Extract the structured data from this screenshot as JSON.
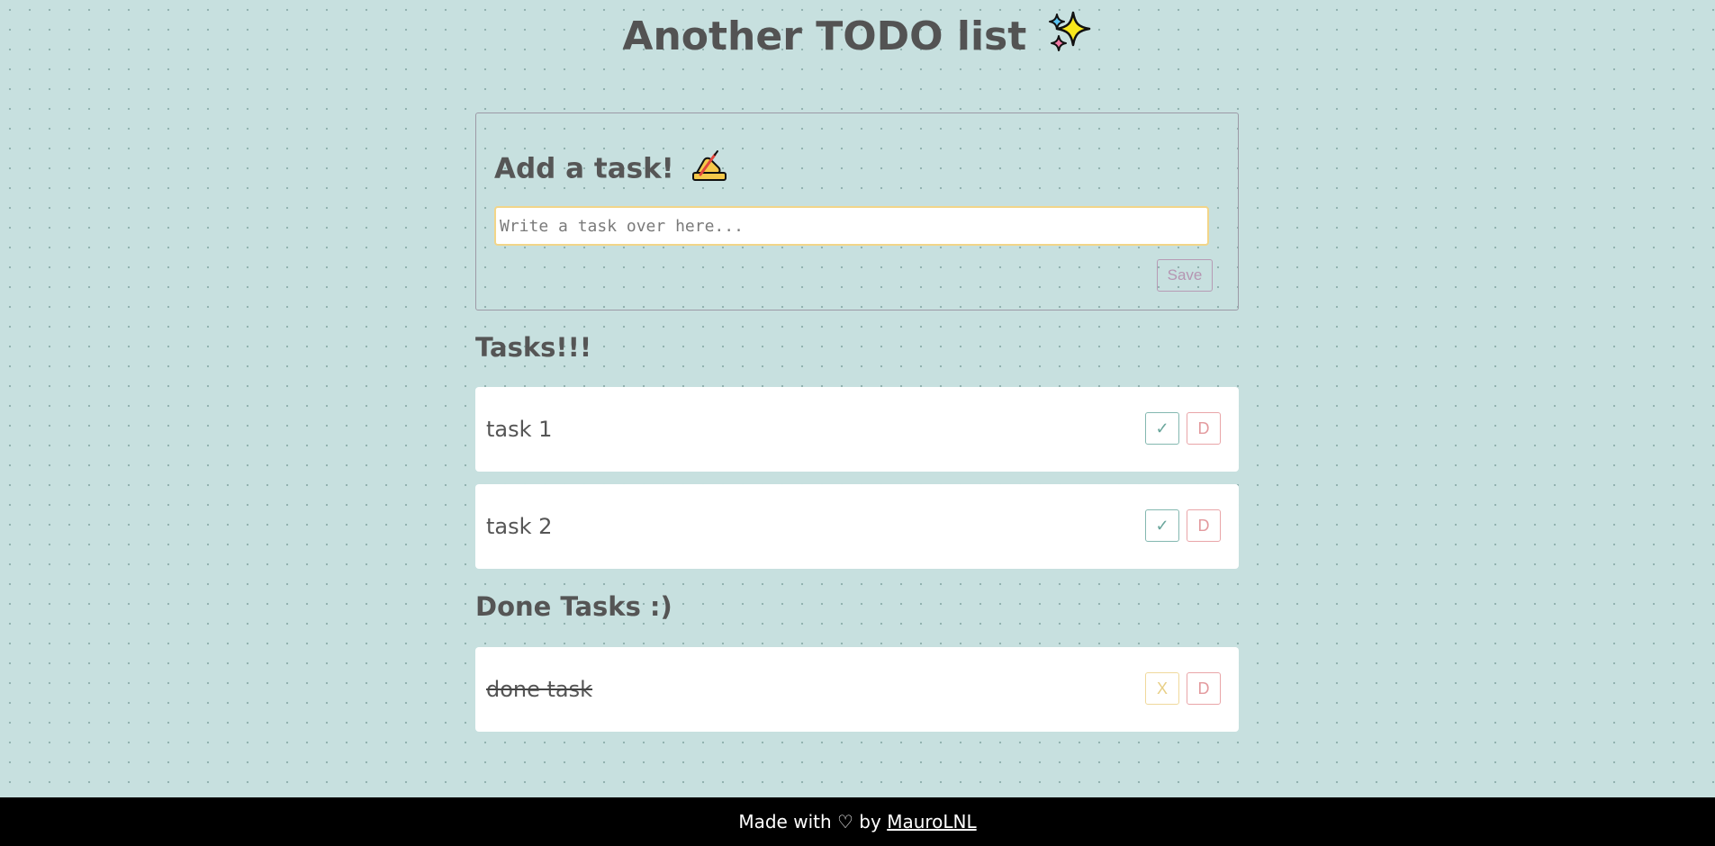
{
  "header": {
    "title": "Another TODO list",
    "title_icon": "sparkles-icon"
  },
  "add_task": {
    "title": "Add a task!",
    "title_icon": "writing-hand-icon",
    "input_placeholder": "Write a task over here...",
    "input_value": "",
    "save_label": "Save"
  },
  "tasks_section": {
    "title": "Tasks!!!",
    "items": [
      {
        "text": "task 1",
        "check_label": "✓",
        "delete_label": "D"
      },
      {
        "text": "task 2",
        "check_label": "✓",
        "delete_label": "D"
      }
    ]
  },
  "done_section": {
    "title": "Done Tasks :)",
    "items": [
      {
        "text": "done task",
        "undo_label": "X",
        "delete_label": "D"
      }
    ]
  },
  "footer": {
    "prefix": "Made with ♡ by",
    "author": "MauroLNL"
  },
  "colors": {
    "background": "#c7e0df",
    "check": "#6aa69c",
    "undo": "#e8cf86",
    "delete": "#e39a9e",
    "save": "#b595b2",
    "input_border": "#f2d589"
  }
}
